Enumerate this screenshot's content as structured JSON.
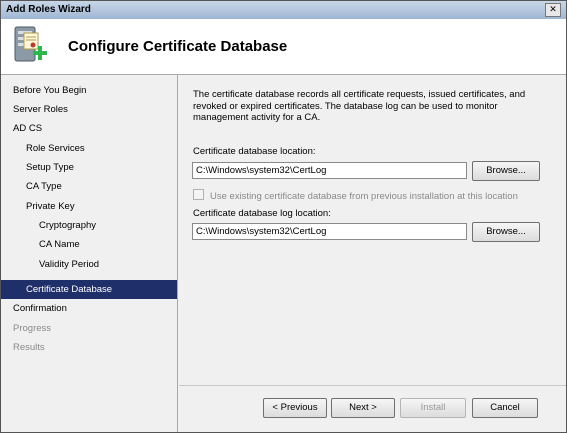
{
  "window": {
    "title": "Add Roles Wizard",
    "close_glyph": "✕"
  },
  "header": {
    "title": "Configure Certificate Database",
    "icon": "server-certificate-add-icon"
  },
  "sidebar": {
    "items": [
      {
        "label": "Before You Begin",
        "level": 0,
        "state": "normal"
      },
      {
        "label": "Server Roles",
        "level": 0,
        "state": "normal"
      },
      {
        "label": "AD CS",
        "level": 0,
        "state": "normal"
      },
      {
        "label": "Role Services",
        "level": 1,
        "state": "normal"
      },
      {
        "label": "Setup Type",
        "level": 1,
        "state": "normal"
      },
      {
        "label": "CA Type",
        "level": 1,
        "state": "normal"
      },
      {
        "label": "Private Key",
        "level": 1,
        "state": "normal"
      },
      {
        "label": "Cryptography",
        "level": 2,
        "state": "normal"
      },
      {
        "label": "CA Name",
        "level": 2,
        "state": "normal"
      },
      {
        "label": "Validity Period",
        "level": 2,
        "state": "normal"
      },
      {
        "label": "Certificate Database",
        "level": 1,
        "state": "active"
      },
      {
        "label": "Confirmation",
        "level": 0,
        "state": "normal"
      },
      {
        "label": "Progress",
        "level": 0,
        "state": "disabled"
      },
      {
        "label": "Results",
        "level": 0,
        "state": "disabled"
      }
    ]
  },
  "content": {
    "description": "The certificate database records all certificate requests, issued certificates, and revoked or expired certificates. The database log can be used to monitor management activity for a CA.",
    "db_location_label": "Certificate database location:",
    "db_location_value": "C:\\Windows\\system32\\CertLog",
    "browse_label": "Browse...",
    "use_existing_label": "Use existing certificate database from previous installation at this location",
    "log_location_label": "Certificate database log location:",
    "log_location_value": "C:\\Windows\\system32\\CertLog"
  },
  "buttons": {
    "previous": "< Previous",
    "next": "Next >",
    "install": "Install",
    "cancel": "Cancel"
  },
  "colors": {
    "active_nav_bg": "#1f2f6a",
    "disabled_text": "#8a8a8a"
  }
}
